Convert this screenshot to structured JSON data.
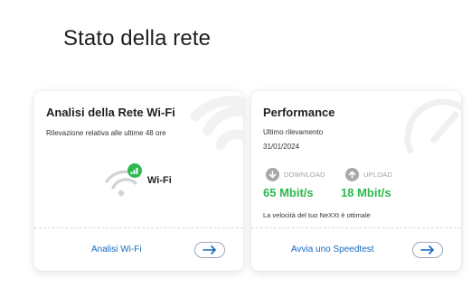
{
  "page": {
    "title": "Stato della rete"
  },
  "wifi_card": {
    "title": "Analisi della Rete Wi-Fi",
    "subtitle": "Rilevazione relativa alle ultime 48 ore",
    "wifi_label": "Wi-Fi",
    "link_label": "Analisi Wi-Fi",
    "icon": "wifi-icon",
    "status_color": "#2eb84f"
  },
  "perf_card": {
    "title": "Performance",
    "last_measure_label": "Ultimo rilevamento",
    "last_measure_date": "31/01/2024",
    "download": {
      "label": "DOWNLOAD",
      "value": "65 Mbit/s"
    },
    "upload": {
      "label": "UPLOAD",
      "value": "18 Mbit/s"
    },
    "note": "La velocità del tuo NeXXt è ottimale",
    "link_label": "Avvia uno Speedtest",
    "value_color": "#2eb84f"
  },
  "colors": {
    "link": "#1769c2",
    "accent_green": "#2eb84f",
    "muted_icon": "#a8a8a8"
  }
}
